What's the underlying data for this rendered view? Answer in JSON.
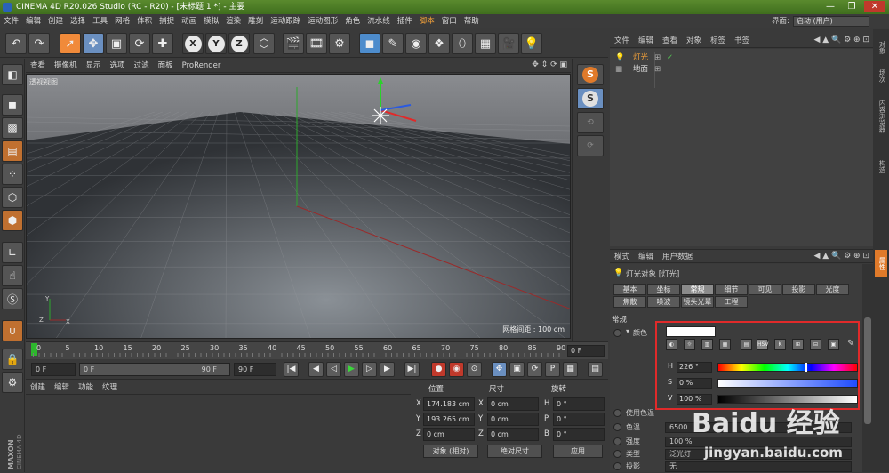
{
  "title": "CINEMA 4D R20.026 Studio (RC - R20) - [未标题 1 *] - 主要",
  "window_controls": {
    "minimize": "—",
    "maximize": "❐",
    "close": "✕"
  },
  "menubar": {
    "items": [
      "文件",
      "编辑",
      "创建",
      "选择",
      "工具",
      "网格",
      "体积",
      "捕捉",
      "动画",
      "模拟",
      "渲染",
      "雕刻",
      "运动跟踪",
      "运动图形",
      "角色",
      "流水线",
      "插件",
      "脚本",
      "窗口",
      "帮助"
    ],
    "highlighted": [
      "脚本"
    ],
    "layout_label": "界面:",
    "layout_value": "启动 (用户)"
  },
  "viewport": {
    "menu": [
      "查看",
      "摄像机",
      "显示",
      "选项",
      "过滤",
      "面板",
      "ProRender"
    ],
    "label": "透视视图",
    "grid_info": "网格间距 : 100 cm"
  },
  "timeline": {
    "ticks": [
      "0",
      "5",
      "10",
      "15",
      "20",
      "25",
      "30",
      "35",
      "40",
      "45",
      "50",
      "55",
      "60",
      "65",
      "70",
      "75",
      "80",
      "85",
      "90"
    ],
    "end_frame": "0 F"
  },
  "transport": {
    "start": "0 F",
    "range_start": "0 F",
    "range_end": "90 F",
    "end": "90 F"
  },
  "material": {
    "menu": [
      "创建",
      "编辑",
      "功能",
      "纹理"
    ]
  },
  "coords": {
    "headers": [
      "位置",
      "尺寸",
      "旋转"
    ],
    "rows": [
      {
        "a": "X",
        "pos": "174.183 cm",
        "b": "X",
        "size": "0 cm",
        "c": "H",
        "rot": "0 °"
      },
      {
        "a": "Y",
        "pos": "193.265 cm",
        "b": "Y",
        "size": "0 cm",
        "c": "P",
        "rot": "0 °"
      },
      {
        "a": "Z",
        "pos": "0 cm",
        "b": "Z",
        "size": "0 cm",
        "c": "B",
        "rot": "0 °"
      }
    ],
    "mode": "对象 (相对)",
    "size_mode": "绝对尺寸",
    "apply": "应用"
  },
  "objects": {
    "menu": [
      "文件",
      "编辑",
      "查看",
      "对象",
      "标签",
      "书签"
    ],
    "items": [
      {
        "name": "灯光",
        "selected": true
      },
      {
        "name": "地面",
        "selected": false
      }
    ]
  },
  "right_tabs": [
    "对象",
    "场次",
    "内容浏览器",
    "构造"
  ],
  "right_tab_attr": "属性",
  "attributes": {
    "menu": [
      "模式",
      "编辑",
      "用户数据"
    ],
    "object_title": "灯光对象 [灯光]",
    "tabs_row1": [
      "基本",
      "坐标",
      "常规",
      "细节",
      "可见",
      "投影",
      "光度"
    ],
    "tabs_row2": [
      "焦散",
      "噪波",
      "镜头光晕",
      "工程"
    ],
    "active_tab": "常规",
    "section": "常规",
    "color_label": "颜色",
    "swatch_labels": [
      "HSV",
      "K"
    ],
    "hsv": [
      {
        "label": "H",
        "value": "226 °"
      },
      {
        "label": "S",
        "value": "0 %"
      },
      {
        "label": "V",
        "value": "100 %"
      }
    ],
    "props": [
      {
        "label": "使用色温",
        "value": ""
      },
      {
        "label": "色温",
        "value": "6500"
      },
      {
        "label": "强度",
        "value": "100 %"
      },
      {
        "label": "类型",
        "value": "泛光灯"
      },
      {
        "label": "投影",
        "value": "无"
      }
    ]
  },
  "watermark": {
    "text": "Baidu 经验",
    "url": "jingyan.baidu.com"
  },
  "colors": {
    "accent": "#f4a23a",
    "highlight_border": "#e02a2a",
    "titlebar": "#4a7c24"
  }
}
